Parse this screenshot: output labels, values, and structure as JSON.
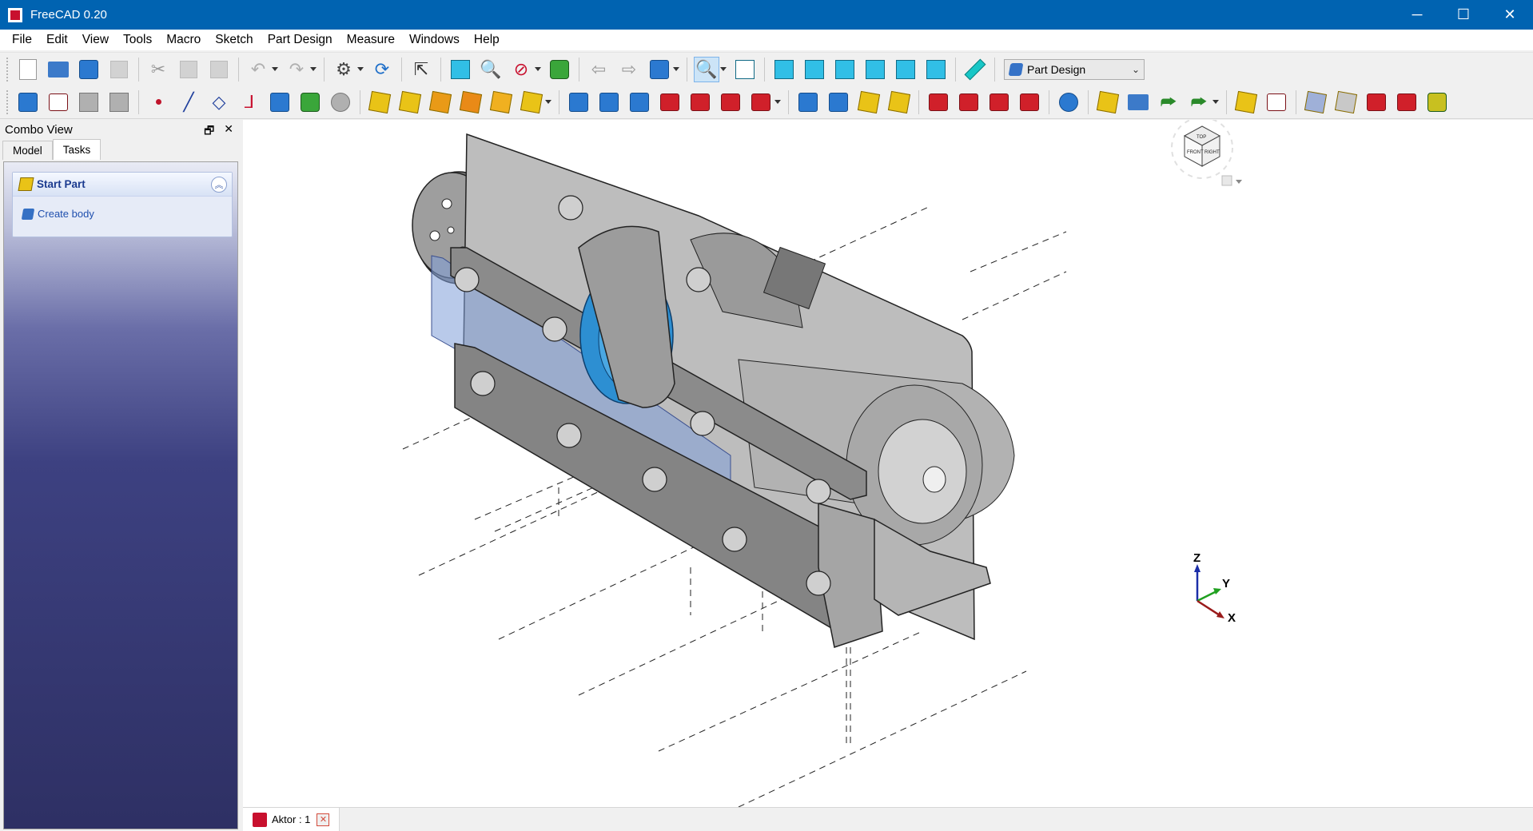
{
  "window": {
    "title": "FreeCAD 0.20",
    "minimize": "─",
    "maximize": "☐",
    "close": "✕"
  },
  "menu": [
    "File",
    "Edit",
    "View",
    "Tools",
    "Macro",
    "Sketch",
    "Part Design",
    "Measure",
    "Windows",
    "Help"
  ],
  "workbench_selector": {
    "value": "Part Design",
    "arrow": "⌄"
  },
  "combo_view": {
    "title": "Combo View",
    "float_icon": "🗗",
    "close_icon": "✕",
    "tabs": [
      "Model",
      "Tasks"
    ],
    "active_tab": "Tasks"
  },
  "task_panel": {
    "box_title": "Start Part",
    "collapse_icon": "︽",
    "link": "Create body"
  },
  "document_tab": {
    "label": "Aktor : 1",
    "close": "✕"
  },
  "axis_labels": {
    "z": "Z",
    "y": "Y",
    "x": "X"
  },
  "navcube": {
    "top_face": "TOP",
    "front_face": "FRONT",
    "right_face": "RIGHT"
  },
  "colors": {
    "title_bar": "#0063b1",
    "task_gradient_bottom": "#2e3064",
    "gear_blue": "#2d8fd2",
    "part_grey": "#c8c8c8",
    "transparent_blue": "#7f9fd8"
  }
}
